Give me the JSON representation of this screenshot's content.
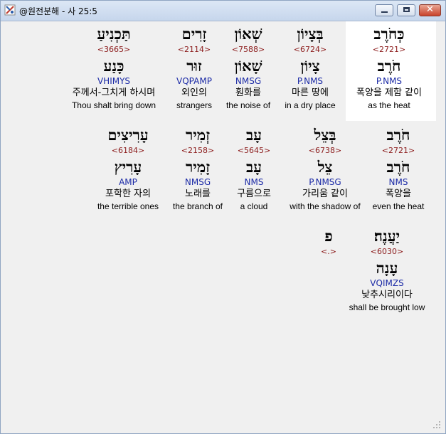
{
  "window": {
    "title": "@원전분해 - 사 25:5"
  },
  "buttons": {
    "minimize": "minimize",
    "maximize": "maximize",
    "close": "✕"
  },
  "rows": [
    {
      "words": [
        {
          "hebrew": "כְּחֹרֶב",
          "strong": "<2721>",
          "lemma": "חֹרֶב",
          "morph": "P.NMS",
          "korean": "폭양을 제함 같이",
          "english": "as the heat",
          "highlighted": true
        },
        {
          "hebrew": "בְּצָיוֹן",
          "strong": "<6724>",
          "lemma": "צָיוֹן",
          "morph": "P.NMS",
          "korean": "마른 땅에",
          "english": "in a dry place"
        },
        {
          "hebrew": "שְׁאוֹן",
          "strong": "<7588>",
          "lemma": "שָׁאוֹן",
          "morph": "NMSG",
          "korean": "훤화를",
          "english": "the noise of"
        },
        {
          "hebrew": "זָרִים",
          "strong": "<2114>",
          "lemma": "זוּר",
          "morph": "VQPAMP",
          "korean": "외인의",
          "english": "strangers"
        },
        {
          "hebrew": "תַּכְנִיעַ",
          "strong": "<3665>",
          "lemma": "כָּנַע",
          "morph": "VHIMYS",
          "korean": "주께서-그치게 하시며",
          "english": "Thou shalt bring down"
        }
      ]
    },
    {
      "words": [
        {
          "hebrew": "חֹרֶב",
          "strong": "<2721>",
          "lemma": "חֹרֶב",
          "morph": "NMS",
          "korean": "폭양을",
          "english": "even the heat"
        },
        {
          "hebrew": "בְּצֵל",
          "strong": "<6738>",
          "lemma": "צֵל",
          "morph": "P.NMSG",
          "korean": "가리움 같이",
          "english": "with the shadow of"
        },
        {
          "hebrew": "עָב",
          "strong": "<5645>",
          "lemma": "עָב",
          "morph": "NMS",
          "korean": "구름으로",
          "english": "a cloud"
        },
        {
          "hebrew": "זְמִיר",
          "strong": "<2158>",
          "lemma": "זָמִיר",
          "morph": "NMSG",
          "korean": "노래를",
          "english": "the branch of"
        },
        {
          "hebrew": "עָרִיצִים",
          "strong": "<6184>",
          "lemma": "עָרִיץ",
          "morph": "AMP",
          "korean": "포학한 자의",
          "english": "the terrible ones"
        }
      ]
    },
    {
      "words": [
        {
          "hebrew": "יַעֲנֶה׃",
          "strong": "<6030>",
          "lemma": "עָנָה",
          "morph": "VQIMZS",
          "korean": "낮추시리이다",
          "english": "shall be brought low"
        },
        {
          "hebrew": "פ",
          "strong": "<.>"
        }
      ]
    }
  ]
}
